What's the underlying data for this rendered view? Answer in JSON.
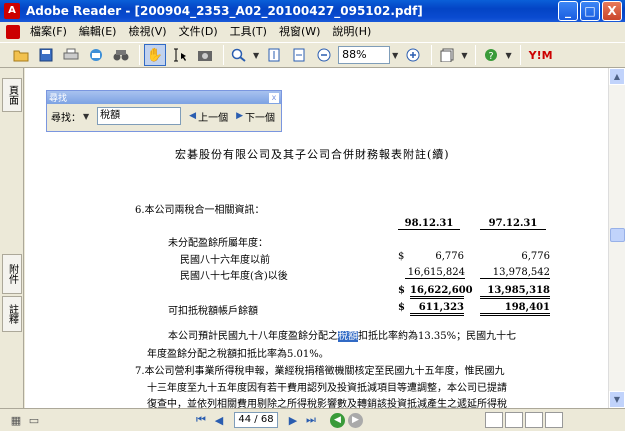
{
  "window": {
    "title": "Adobe Reader - [200904_2353_A02_20100427_095102.pdf]",
    "minimize_label": "_",
    "restore_label": "□",
    "close_label": "X"
  },
  "menubar": [
    "檔案(F)",
    "編輯(E)",
    "檢視(V)",
    "文件(D)",
    "工具(T)",
    "視窗(W)",
    "說明(H)"
  ],
  "toolbar": {
    "zoom_value": "88%",
    "yahoo_label": "Y!M"
  },
  "nav_tabs": {
    "pages": "頁面",
    "attachments": "附件",
    "comments": "註釋"
  },
  "find": {
    "title": "尋找",
    "label": "尋找：",
    "value": "稅額",
    "prev_label": "上一個",
    "next_label": "下一個",
    "close_label": "x"
  },
  "document": {
    "heading": "宏碁股份有限公司及其子公司合併財務報表附註(續)",
    "section": "6.本公司兩稅合一相關資訊：",
    "col1": "98.12.31",
    "col2": "97.12.31",
    "undistributed": "未分配盈餘所屬年度：",
    "row1_label": "民國八十六年度以前",
    "row1_cur": "$",
    "row1_v1": "6,776",
    "row1_v2": "6,776",
    "row2_label": "民國八十七年度(含)以後",
    "row2_v1": "16,615,824",
    "row2_v2": "13,978,542",
    "total_cur": "$",
    "total_v1": "16,622,600",
    "total_v2": "13,985,318",
    "deduct_label": "可扣抵稅額帳戶餘額",
    "deduct_cur": "$",
    "deduct_v1": "611,323",
    "deduct_v2": "198,401",
    "para1_a": "本公司預計民國九十八年度盈餘分配之",
    "para1_hl": "稅額",
    "para1_b": "扣抵比率約為13.35%；民國九十七",
    "para1_line2": "年度盈餘分配之稅額扣抵比率為5.01%。",
    "para2_line1": "7.本公司營利事業所得稅申報，業經稅捐稽徵機關核定至民國九十五年度，惟民國九",
    "para2_line2": "十三年度至九十五年度因有若干費用認列及投資抵減項目等遭調整，本公司已提請",
    "para2_line3": "復查中，並依列相關費用剔除之所得稅影響數及轉銷該投資抵減產生之遞延所得稅"
  },
  "statusbar": {
    "page_value": "44 / 68"
  }
}
